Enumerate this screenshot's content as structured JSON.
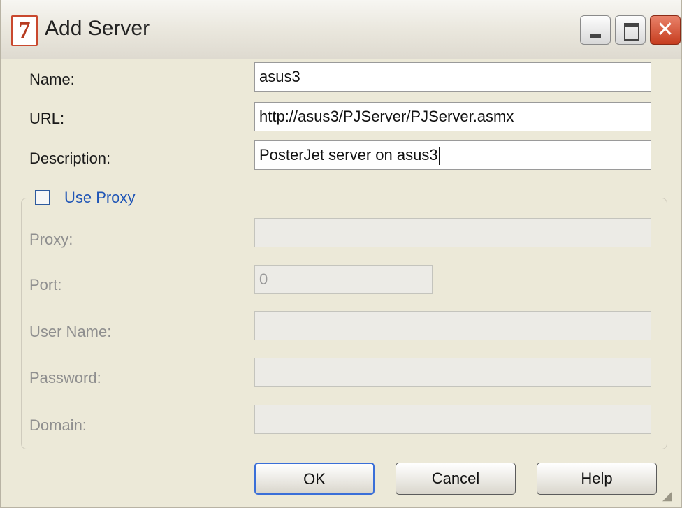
{
  "window": {
    "title": "Add Server",
    "icon_glyph": "7",
    "close_glyph": "✕"
  },
  "form": {
    "name": {
      "label": "Name:",
      "value": "asus3"
    },
    "url": {
      "label": "URL:",
      "value": "http://asus3/PJServer/PJServer.asmx"
    },
    "description": {
      "label": "Description:",
      "value": "PosterJet server on asus3"
    }
  },
  "proxy_group": {
    "use_proxy_label": "Use Proxy",
    "use_proxy_checked": false,
    "proxy": {
      "label": "Proxy:",
      "value": ""
    },
    "port": {
      "label": "Port:",
      "value": "0"
    },
    "user_name": {
      "label": "User Name:",
      "value": ""
    },
    "password": {
      "label": "Password:",
      "value": ""
    },
    "domain": {
      "label": "Domain:",
      "value": ""
    }
  },
  "buttons": {
    "ok": "OK",
    "cancel": "Cancel",
    "help": "Help"
  },
  "colors": {
    "dialog_bg": "#ece9d8",
    "link_blue": "#1f55b6",
    "close_red": "#c63d1f",
    "disabled_text": "#8f8f8f"
  },
  "icons": [
    "app-icon",
    "minimize-icon",
    "maximize-icon",
    "close-icon",
    "resize-grip-icon"
  ]
}
